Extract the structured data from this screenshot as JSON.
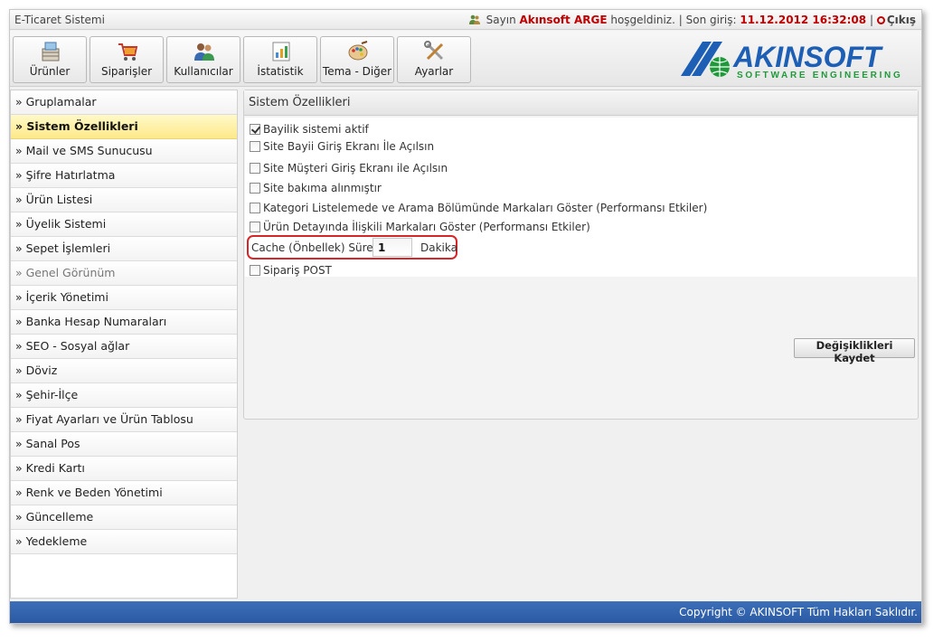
{
  "app": {
    "title": "E-Ticaret Sistemi"
  },
  "user": {
    "greeting_prefix": "Sayın",
    "name": "Akınsoft ARGE",
    "greeting_suffix": "hoşgeldiniz.",
    "separator": "|",
    "last_login_label": "Son giriş:",
    "last_login_value": "11.12.2012 16:32:08",
    "separator2": "|",
    "logout_label": "Çıkış"
  },
  "toolbar": {
    "buttons": [
      {
        "label": "Ürünler",
        "icon": "box-icon"
      },
      {
        "label": "Siparişler",
        "icon": "cart-icon"
      },
      {
        "label": "Kullanıcılar",
        "icon": "users-icon"
      },
      {
        "label": "İstatistik",
        "icon": "stats-icon"
      },
      {
        "label": "Tema - Diğer",
        "icon": "palette-icon"
      },
      {
        "label": "Ayarlar",
        "icon": "tools-icon"
      }
    ]
  },
  "logo": {
    "name": "AKINSOFT",
    "tagline": "SOFTWARE ENGINEERING",
    "brand_color": "#1d5fb4",
    "globe_color": "#1f9a3a"
  },
  "sidebar": {
    "items": [
      {
        "label": "» Gruplamalar"
      },
      {
        "label": "» Sistem Özellikleri"
      },
      {
        "label": "» Mail ve SMS Sunucusu"
      },
      {
        "label": "» Şifre Hatırlatma"
      },
      {
        "label": "» Ürün Listesi"
      },
      {
        "label": "» Üyelik Sistemi"
      },
      {
        "label": "» Sepet İşlemleri"
      },
      {
        "label": "» Genel Görünüm"
      },
      {
        "label": "» İçerik Yönetimi"
      },
      {
        "label": "» Banka Hesap Numaraları"
      },
      {
        "label": "» SEO - Sosyal ağlar"
      },
      {
        "label": "» Döviz"
      },
      {
        "label": "» Şehir-İlçe"
      },
      {
        "label": "» Fiyat Ayarları ve Ürün Tablosu"
      },
      {
        "label": "» Sanal Pos"
      },
      {
        "label": "» Kredi Kartı"
      },
      {
        "label": "» Renk ve Beden Yönetimi"
      },
      {
        "label": "» Güncelleme"
      },
      {
        "label": "» Yedekleme"
      }
    ]
  },
  "main": {
    "title": "Sistem Özellikleri",
    "options": [
      {
        "label": "Bayilik sistemi aktif",
        "checked": true
      },
      {
        "label": "Site Bayii Giriş Ekranı İle Açılsın",
        "checked": false
      },
      {
        "label": "Site Müşteri Giriş Ekranı ile Açılsın",
        "checked": false
      },
      {
        "label": "Site bakıma alınmıştır",
        "checked": false
      },
      {
        "label": "Kategori Listelemede ve Arama Bölümünde Markaları Göster (Performansı Etkiler)",
        "checked": false
      },
      {
        "label": "Ürün Detayında İlişkili Markaları Göster (Performansı Etkiler)",
        "checked": false
      }
    ],
    "cache": {
      "label": "Cache (Önbellek) Süresi",
      "value": "1",
      "unit": "Dakika"
    },
    "post_option": {
      "label": "Sipariş POST",
      "checked": false
    },
    "save_label": "Değişiklikleri Kaydet"
  },
  "footer": {
    "copyright": "Copyright © AKINSOFT Tüm Hakları Saklıdır."
  },
  "colors": {
    "active_item": "#fde98a",
    "footer_blue": "#2a5aa3",
    "highlight_red": "#d6262a"
  }
}
